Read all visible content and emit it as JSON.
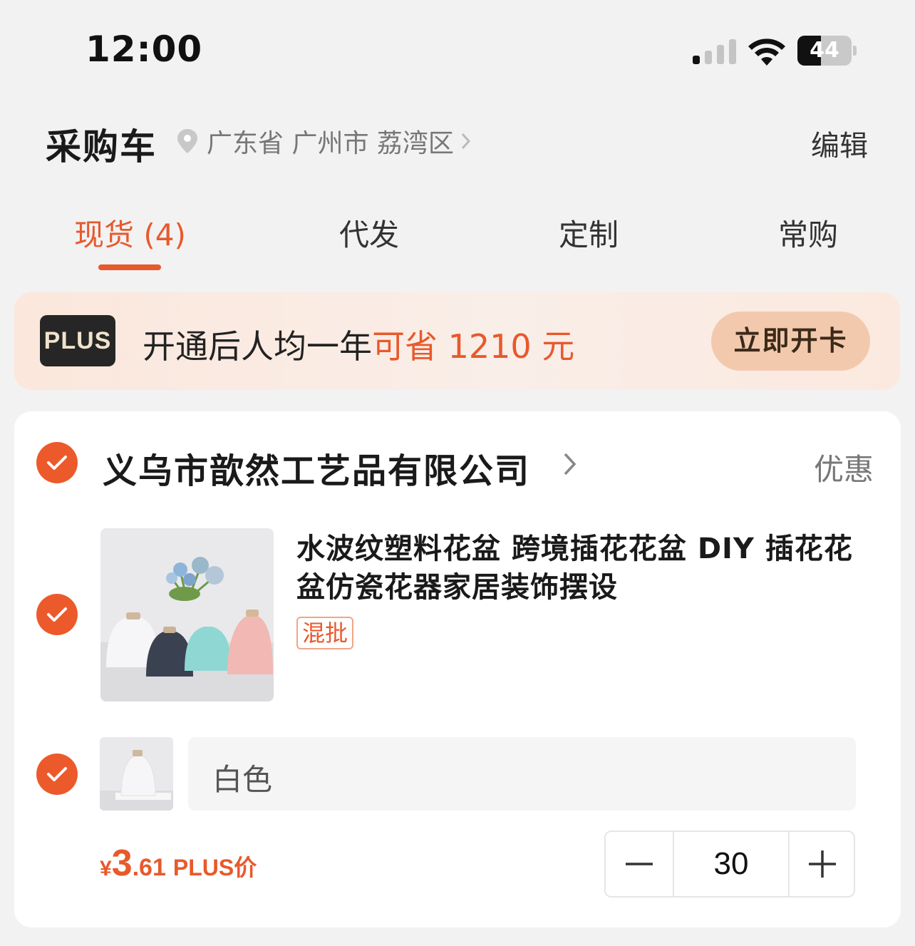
{
  "status_bar": {
    "time": "12:00",
    "battery": "44",
    "battery_level": 0.44
  },
  "header": {
    "title": "采购车",
    "location": "广东省 广州市 荔湾区",
    "edit_label": "编辑"
  },
  "tabs": [
    {
      "label": "现货 (4)",
      "active": true
    },
    {
      "label": "代发",
      "active": false
    },
    {
      "label": "定制",
      "active": false
    },
    {
      "label": "常购",
      "active": false
    }
  ],
  "plus_banner": {
    "badge": "PLUS",
    "text_prefix": "开通后人均一年",
    "text_highlight": "可省 1210 元",
    "button_label": "立即开卡"
  },
  "shop": {
    "name": "义乌市歆然工艺品有限公司",
    "discount_label": "优惠",
    "checked": true
  },
  "product": {
    "title": "水波纹塑料花盆 跨境插花花盆 DIY 插花花盆仿瓷花器家居装饰摆设",
    "tag": "混批",
    "checked": true
  },
  "sku": {
    "label": "白色",
    "checked": true,
    "currency": "¥",
    "price_int": "3",
    "price_dec": ".61",
    "price_tag": "PLUS价",
    "quantity": "30"
  },
  "colors": {
    "accent": "#e8592c",
    "check": "#ec5a2b",
    "plus_button": "#f3c9ad"
  }
}
